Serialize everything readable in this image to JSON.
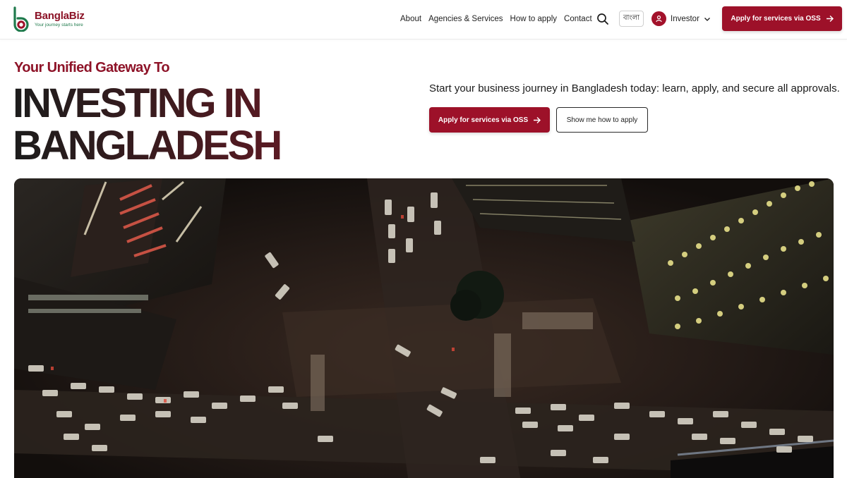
{
  "brand": {
    "name": "BanglaBiz",
    "tagline": "Your journey starts here",
    "colors": {
      "primary": "#9d1129",
      "secondary": "#1f7a4c"
    }
  },
  "nav": {
    "links": [
      "About",
      "Agencies & Services",
      "How to apply",
      "Contact"
    ],
    "search_icon": "search-icon",
    "language_toggle": "বাংলা",
    "user_menu": {
      "label": "Investor",
      "icon": "user-icon"
    },
    "cta": {
      "label": "Apply for services via OSS",
      "icon": "arrow-right-icon"
    }
  },
  "hero": {
    "eyebrow": "Your Unified Gateway To",
    "headline_line1": "INVESTING IN",
    "headline_line2": "BANGLADESH",
    "lead": "Start your business journey in Bangladesh today: learn, apply, and secure all approvals.",
    "primary_button": "Apply for services via OSS",
    "secondary_button": "Show me how to apply",
    "image": "aerial-night-city-intersection"
  }
}
